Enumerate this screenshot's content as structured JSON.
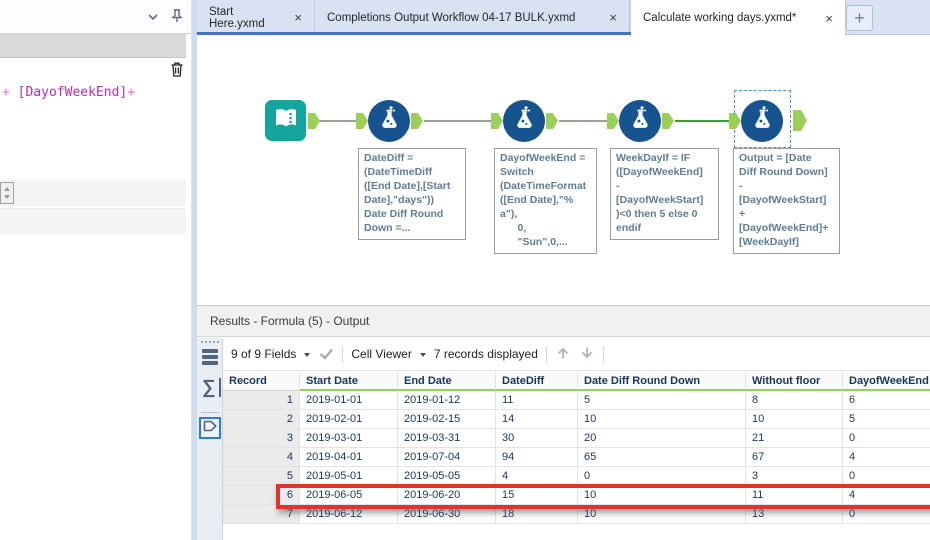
{
  "colors": {
    "tool_formula_blue": "#17538f",
    "tool_input_teal": "#14a59d",
    "anchor_green": "#9ccf58",
    "selected_connection_green": "#35a135",
    "header_underline_green": "#8ed35e",
    "highlight_red": "#e0342a",
    "tab_strip_blue": "#d8e2f2",
    "tab_underline_blue": "#4273c9",
    "expression_field_magenta": "#bf28bf",
    "expression_operator_pink": "#ff5fe0"
  },
  "left_panel": {
    "expression": {
      "op_before": "+",
      "field": "[DayofWeekEnd]",
      "op_after": "+"
    }
  },
  "tab_bar": {
    "tabs": [
      {
        "label": "Start Here.yxmd"
      },
      {
        "label": "Completions Output Workflow 04-17 BULK.yxmd"
      },
      {
        "label": "Calculate working days.yxmd*"
      }
    ],
    "close_glyph": "×",
    "new_tab_glyph": "+"
  },
  "canvas": {
    "annotations": [
      {
        "text": "DateDiff =\n(DateTimeDiff\n([End Date],[Start\nDate],\"days\"))\nDate Diff Round\nDown =..."
      },
      {
        "text": "DayofWeekEnd =\nSwitch\n(DateTimeFormat\n([End Date],\"%\na\"),\n      0,\n      \"Sun\",0,..."
      },
      {
        "text": "WeekDayIf = IF\n([DayofWeekEnd]\n-\n[DayofWeekStart]\n)<0 then 5 else 0\nendif"
      },
      {
        "text": "Output = [Date\nDiff Round Down]\n-\n[DayofWeekStart]\n+\n[DayofWeekEnd]+\n[WeekDayIf]"
      }
    ]
  },
  "results": {
    "title": "Results - Formula (5) - Output",
    "toolbar": {
      "fields_dropdown": "9 of 9 Fields",
      "cell_viewer": "Cell Viewer",
      "records_displayed": "7 records displayed"
    },
    "sidebar": {
      "sigma_glyph": "∑"
    },
    "table": {
      "columns": [
        "Record",
        "Start Date",
        "End Date",
        "DateDiff",
        "Date Diff Round Down",
        "Without floor",
        "DayofWeekEnd"
      ],
      "rows": [
        [
          "1",
          "2019-01-01",
          "2019-01-12",
          "11",
          "5",
          "8",
          "6"
        ],
        [
          "2",
          "2019-02-01",
          "2019-02-15",
          "14",
          "10",
          "10",
          "5"
        ],
        [
          "3",
          "2019-03-01",
          "2019-03-31",
          "30",
          "20",
          "21",
          "0"
        ],
        [
          "4",
          "2019-04-01",
          "2019-07-04",
          "94",
          "65",
          "67",
          "4"
        ],
        [
          "5",
          "2019-05-01",
          "2019-05-05",
          "4",
          "0",
          "3",
          "0"
        ],
        [
          "6",
          "2019-06-05",
          "2019-06-20",
          "15",
          "10",
          "11",
          "4"
        ],
        [
          "7",
          "2019-06-12",
          "2019-06-30",
          "18",
          "10",
          "13",
          "0"
        ]
      ],
      "highlighted_record": "6"
    }
  }
}
